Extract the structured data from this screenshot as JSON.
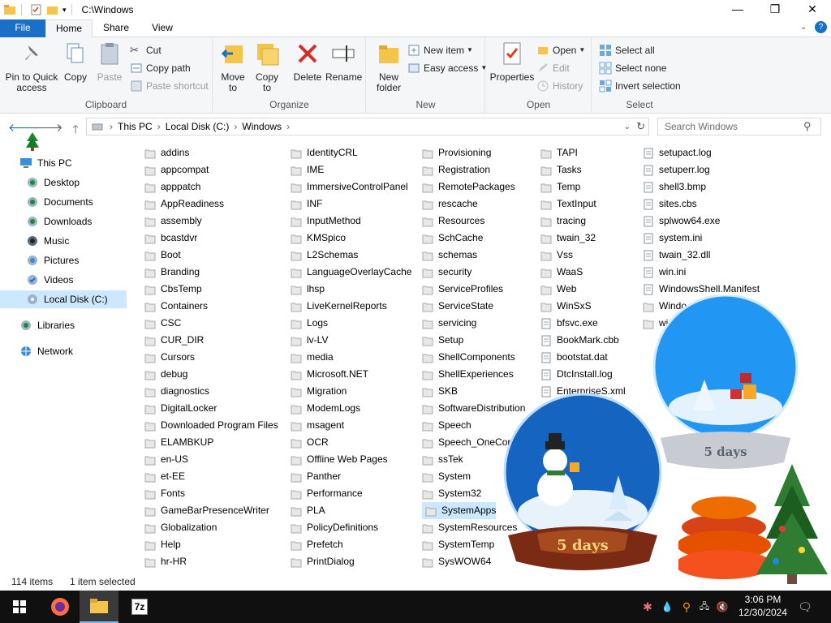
{
  "window": {
    "title": "C:\\Windows",
    "minimize": "—",
    "maximize": "❐",
    "close": "✕"
  },
  "tabs": {
    "file": "File",
    "home": "Home",
    "share": "Share",
    "view": "View"
  },
  "ribbon": {
    "clipboard": {
      "label": "Clipboard",
      "pin": "Pin to Quick access",
      "copy": "Copy",
      "paste": "Paste",
      "cut": "Cut",
      "copy_path": "Copy path",
      "paste_shortcut": "Paste shortcut"
    },
    "organize": {
      "label": "Organize",
      "move_to": "Move to",
      "copy_to": "Copy to",
      "delete": "Delete",
      "rename": "Rename"
    },
    "new": {
      "label": "New",
      "new_folder": "New folder",
      "new_item": "New item",
      "easy_access": "Easy access"
    },
    "open": {
      "label": "Open",
      "properties": "Properties",
      "open": "Open",
      "edit": "Edit",
      "history": "History"
    },
    "select": {
      "label": "Select",
      "select_all": "Select all",
      "select_none": "Select none",
      "invert": "Invert selection"
    }
  },
  "address": {
    "crumbs": [
      "This PC",
      "Local Disk (C:)",
      "Windows"
    ],
    "search_placeholder": "Search Windows"
  },
  "nav": {
    "this_pc": "This PC",
    "desktop": "Desktop",
    "documents": "Documents",
    "downloads": "Downloads",
    "music": "Music",
    "pictures": "Pictures",
    "videos": "Videos",
    "local_disk": "Local Disk (C:)",
    "libraries": "Libraries",
    "network": "Network"
  },
  "files": {
    "col1": [
      "addins",
      "appcompat",
      "apppatch",
      "AppReadiness",
      "assembly",
      "bcastdvr",
      "Boot",
      "Branding",
      "CbsTemp",
      "Containers",
      "CSC",
      "CUR_DIR",
      "Cursors",
      "debug",
      "diagnostics",
      "DigitalLocker",
      "Downloaded Program Files",
      "ELAMBKUP",
      "en-US",
      "et-EE",
      "Fonts",
      "GameBarPresenceWriter",
      "Globalization",
      "Help",
      "hr-HR"
    ],
    "col2": [
      "IdentityCRL",
      "IME",
      "ImmersiveControlPanel",
      "INF",
      "InputMethod",
      "KMSpico",
      "L2Schemas",
      "LanguageOverlayCache",
      "lhsp",
      "LiveKernelReports",
      "Logs",
      "lv-LV",
      "media",
      "Microsoft.NET",
      "Migration",
      "ModemLogs",
      "msagent",
      "OCR",
      "Offline Web Pages",
      "Panther",
      "Performance",
      "PLA",
      "PolicyDefinitions",
      "Prefetch",
      "PrintDialog"
    ],
    "col3": [
      "Provisioning",
      "Registration",
      "RemotePackages",
      "rescache",
      "Resources",
      "SchCache",
      "schemas",
      "security",
      "ServiceProfiles",
      "ServiceState",
      "servicing",
      "Setup",
      "ShellComponents",
      "ShellExperiences",
      "SKB",
      "SoftwareDistribution",
      "Speech",
      "Speech_OneCore",
      "ssTek",
      "System",
      "System32",
      "SystemApps",
      "SystemResources",
      "SystemTemp",
      "SysWOW64"
    ],
    "col4": [
      "TAPI",
      "Tasks",
      "Temp",
      "TextInput",
      "tracing",
      "twain_32",
      "Vss",
      "WaaS",
      "Web",
      "WinSxS",
      "bfsvc.exe",
      "BookMark.cbb",
      "bootstat.dat",
      "DtcInstall.log",
      "EnterpriseS.xml"
    ],
    "col5": [
      "setupact.log",
      "setuperr.log",
      "shell3.bmp",
      "sites.cbs",
      "splwow64.exe",
      "system.ini",
      "twain_32.dll",
      "win.ini",
      "WindowsShell.Manifest",
      "Windo",
      "wi"
    ],
    "selected": "SystemApps"
  },
  "status": {
    "count": "114 items",
    "selected": "1 item selected"
  },
  "globes": {
    "label": "5 days"
  },
  "taskbar": {
    "time": "3:06 PM",
    "date": "12/30/2024",
    "sevenzip": "7z"
  },
  "colors": {
    "accent": "#1a6fc9",
    "folder": "#f4c54a",
    "selection": "#cce8ff"
  }
}
